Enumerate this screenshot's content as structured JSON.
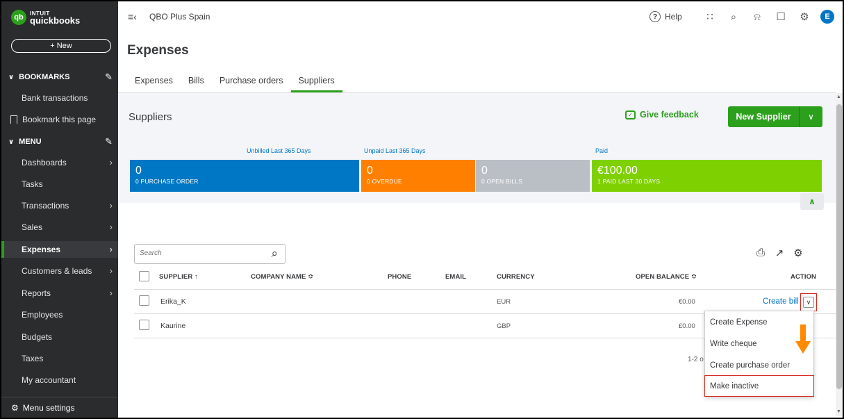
{
  "brand": {
    "line1": "INTUIT",
    "line2": "quickbooks",
    "badge": "qb"
  },
  "sidebar": {
    "new_label": "+ New",
    "bookmarks_label": "BOOKMARKS",
    "bookmark_items": [
      "Bank transactions",
      "Bookmark this page"
    ],
    "menu_label": "MENU",
    "items": [
      {
        "label": "Dashboards",
        "arrow": true
      },
      {
        "label": "Tasks",
        "arrow": false
      },
      {
        "label": "Transactions",
        "arrow": true
      },
      {
        "label": "Sales",
        "arrow": true
      },
      {
        "label": "Expenses",
        "arrow": true,
        "active": true
      },
      {
        "label": "Customers & leads",
        "arrow": true
      },
      {
        "label": "Reports",
        "arrow": true
      },
      {
        "label": "Employees",
        "arrow": false
      },
      {
        "label": "Budgets",
        "arrow": false
      },
      {
        "label": "Taxes",
        "arrow": false
      },
      {
        "label": "My accountant",
        "arrow": false
      }
    ],
    "settings_label": "Menu settings"
  },
  "topbar": {
    "company": "QBO Plus Spain",
    "help_label": "Help",
    "avatar_initial": "E"
  },
  "page": {
    "title": "Expenses"
  },
  "tabs": [
    "Expenses",
    "Bills",
    "Purchase orders",
    "Suppliers"
  ],
  "active_tab": "Suppliers",
  "suppliers_panel": {
    "title": "Suppliers",
    "feedback_label": "Give feedback",
    "new_supplier_label": "New Supplier",
    "band_labels": {
      "unbilled": "Unbilled Last 365 Days",
      "unpaid": "Unpaid Last 365 Days",
      "paid": "Paid"
    },
    "boxes": [
      {
        "amount": "0",
        "caption": "0  PURCHASE ORDER",
        "color": "#0077c5"
      },
      {
        "amount": "0",
        "caption": "0  OVERDUE",
        "color": "#ff8000"
      },
      {
        "amount": "0",
        "caption": "0  OPEN BILLS",
        "color": "#babec5"
      },
      {
        "amount": "€100.00",
        "caption": "1  PAID LAST 30 DAYS",
        "color": "#7fd000"
      }
    ]
  },
  "table": {
    "search_placeholder": "Search",
    "headers": {
      "supplier": "SUPPLIER ↑",
      "company": "COMPANY NAME ≎",
      "phone": "PHONE",
      "email": "EMAIL",
      "currency": "CURRENCY",
      "balance": "OPEN BALANCE ≎",
      "action": "ACTION"
    },
    "rows": [
      {
        "supplier": "Erika_K",
        "currency": "EUR",
        "balance": "€0.00",
        "action": "Create bill"
      },
      {
        "supplier": "Kaurine",
        "currency": "GBP",
        "balance": "£0.00"
      }
    ],
    "pager": "1-2 o"
  },
  "action_menu": [
    "Create Expense",
    "Write cheque",
    "Create purchase order",
    "Make inactive"
  ],
  "colors": {
    "brand_green": "#2ca01c",
    "sidebar_bg": "#2b2c2e",
    "highlight_red": "#d52b1e",
    "annotation_orange": "#ff8a00"
  }
}
